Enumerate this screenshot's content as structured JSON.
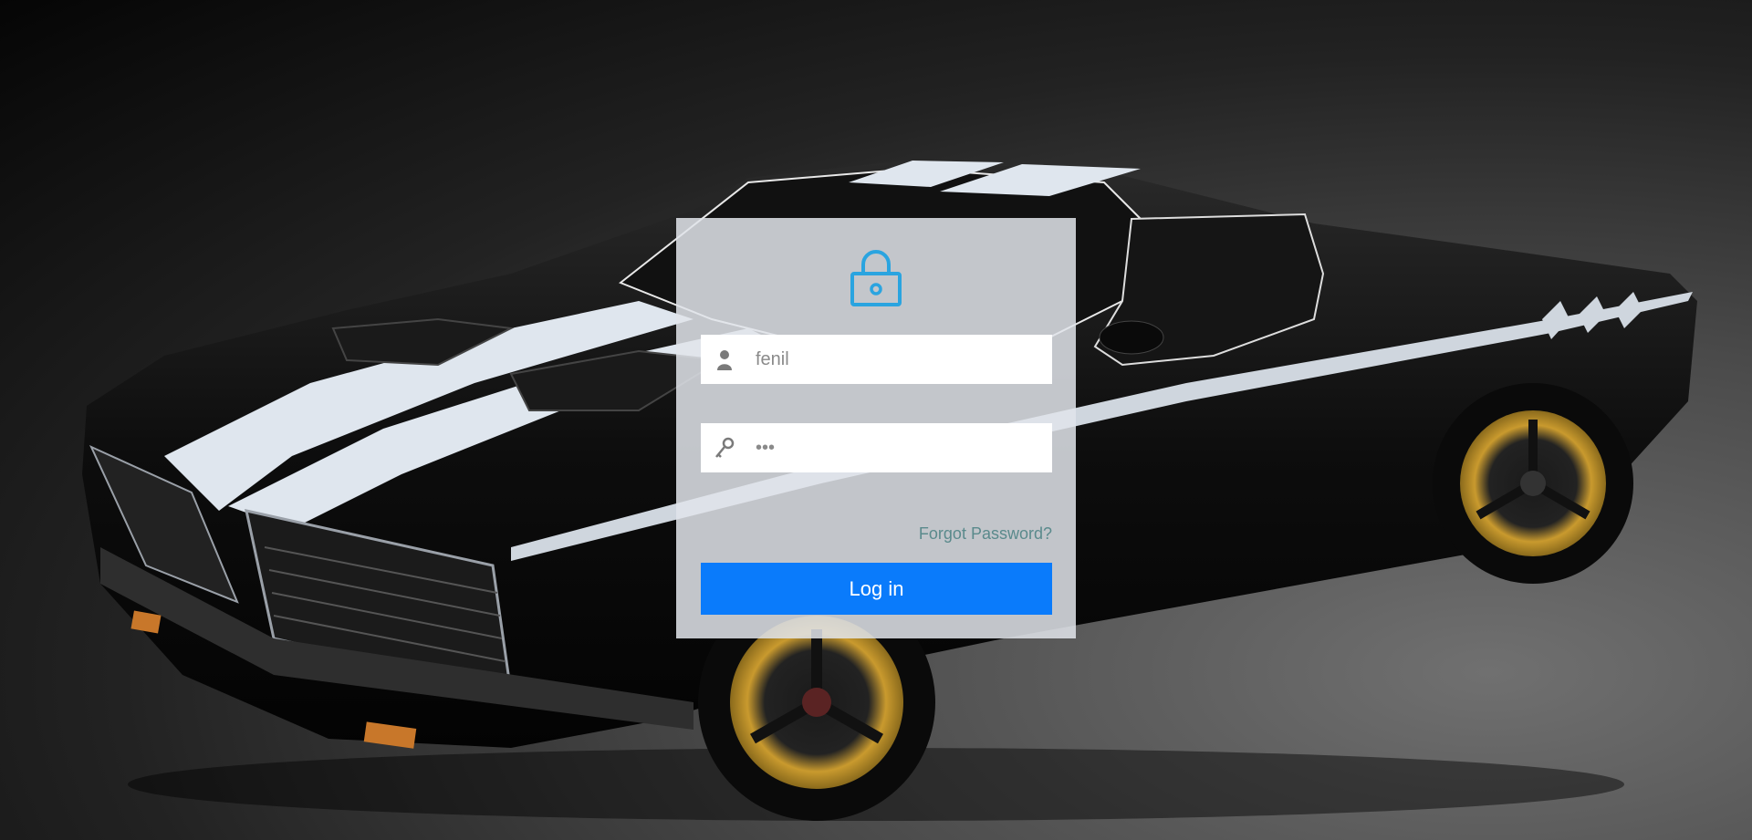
{
  "login": {
    "username": {
      "icon": "user-icon",
      "value": "fenil"
    },
    "password": {
      "icon": "key-icon",
      "value": "•••"
    },
    "forgot_password_label": "Forgot Password?",
    "login_button_label": "Log in",
    "lock_icon": "lock-icon"
  },
  "colors": {
    "accent": "#0a7bfb",
    "lock_icon": "#2aa4e0",
    "forgot_link": "#5a8a8c",
    "card_background": "#e1e4ea"
  },
  "background": {
    "icon": "muscle-car-illustration"
  }
}
